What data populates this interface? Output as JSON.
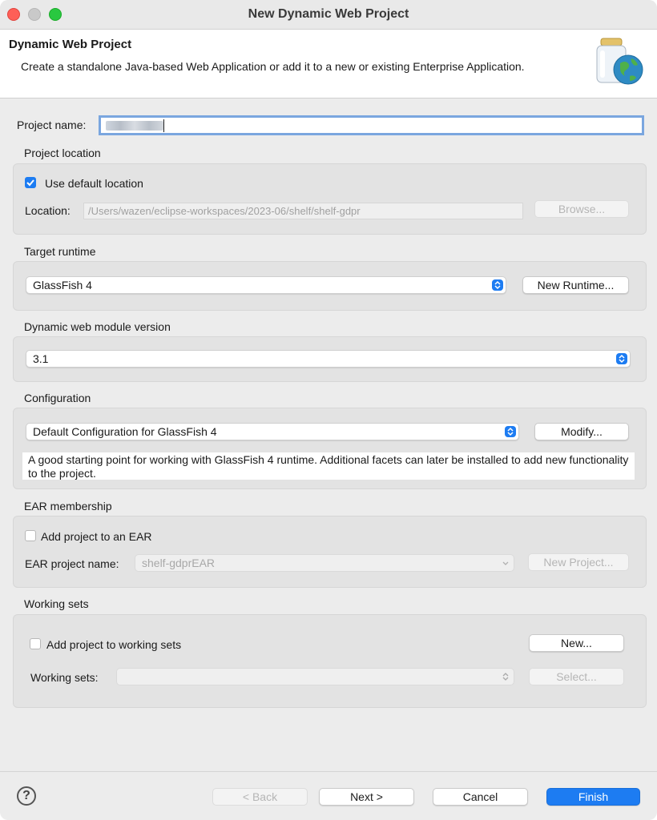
{
  "window": {
    "title": "New Dynamic Web Project"
  },
  "banner": {
    "title": "Dynamic Web Project",
    "description": "Create a standalone Java-based Web Application or add it to a new or existing Enterprise Application."
  },
  "project_name": {
    "label": "Project name:",
    "value": ""
  },
  "project_location": {
    "heading": "Project location",
    "use_default_label": "Use default location",
    "use_default_checked": true,
    "location_label": "Location:",
    "location_value": "/Users/wazen/eclipse-workspaces/2023-06/shelf/shelf-gdpr",
    "browse_label": "Browse..."
  },
  "target_runtime": {
    "heading": "Target runtime",
    "selected": "GlassFish 4",
    "new_runtime_label": "New Runtime..."
  },
  "module_version": {
    "heading": "Dynamic web module version",
    "selected": "3.1"
  },
  "configuration": {
    "heading": "Configuration",
    "selected": "Default Configuration for GlassFish 4",
    "modify_label": "Modify...",
    "description": "A good starting point for working with GlassFish 4 runtime. Additional facets can later be installed to add new functionality to the project."
  },
  "ear": {
    "heading": "EAR membership",
    "add_label": "Add project to an EAR",
    "add_checked": false,
    "project_name_label": "EAR project name:",
    "project_name_value": "shelf-gdprEAR",
    "new_project_label": "New Project..."
  },
  "working_sets": {
    "heading": "Working sets",
    "add_label": "Add project to working sets",
    "add_checked": false,
    "new_label": "New...",
    "sets_label": "Working sets:",
    "sets_value": "",
    "select_label": "Select..."
  },
  "footer": {
    "help_glyph": "?",
    "back_label": "< Back",
    "next_label": "Next >",
    "cancel_label": "Cancel",
    "finish_label": "Finish"
  },
  "colors": {
    "accent": "#1d7cf2",
    "close": "#fe5f57",
    "maximize": "#29c840"
  }
}
